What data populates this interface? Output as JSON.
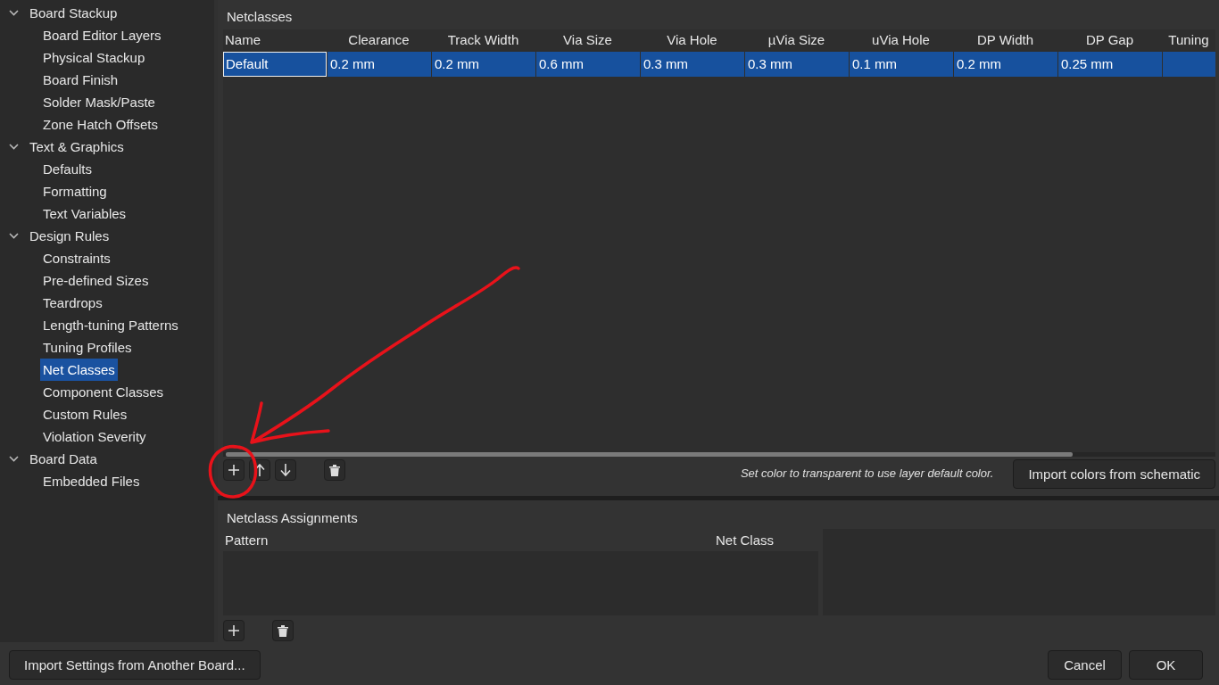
{
  "sidebar": {
    "items": [
      {
        "label": "Board Stackup",
        "expanded": true,
        "selected": false,
        "children": [
          {
            "label": "Board Editor Layers",
            "selected": false
          },
          {
            "label": "Physical Stackup",
            "selected": false
          },
          {
            "label": "Board Finish",
            "selected": false
          },
          {
            "label": "Solder Mask/Paste",
            "selected": false
          },
          {
            "label": "Zone Hatch Offsets",
            "selected": false
          }
        ]
      },
      {
        "label": "Text & Graphics",
        "expanded": true,
        "selected": false,
        "children": [
          {
            "label": "Defaults",
            "selected": false
          },
          {
            "label": "Formatting",
            "selected": false
          },
          {
            "label": "Text Variables",
            "selected": false
          }
        ]
      },
      {
        "label": "Design Rules",
        "expanded": true,
        "selected": false,
        "children": [
          {
            "label": "Constraints",
            "selected": false
          },
          {
            "label": "Pre-defined Sizes",
            "selected": false
          },
          {
            "label": "Teardrops",
            "selected": false
          },
          {
            "label": "Length-tuning Patterns",
            "selected": false
          },
          {
            "label": "Tuning Profiles",
            "selected": false
          },
          {
            "label": "Net Classes",
            "selected": true
          },
          {
            "label": "Component Classes",
            "selected": false
          },
          {
            "label": "Custom Rules",
            "selected": false
          },
          {
            "label": "Violation Severity",
            "selected": false
          }
        ]
      },
      {
        "label": "Board Data",
        "expanded": true,
        "selected": false,
        "children": [
          {
            "label": "Embedded Files",
            "selected": false
          }
        ]
      }
    ]
  },
  "netclasses": {
    "title": "Netclasses",
    "columns": [
      "Name",
      "Clearance",
      "Track Width",
      "Via Size",
      "Via Hole",
      "µVia Size",
      "uVia Hole",
      "DP Width",
      "DP Gap",
      "Tuning"
    ],
    "rows": [
      {
        "selected": true,
        "cells": [
          {
            "text": "Default",
            "focused": true
          },
          {
            "text": "0.2 mm",
            "focused": false
          },
          {
            "text": "0.2 mm",
            "focused": false
          },
          {
            "text": "0.6 mm",
            "focused": false
          },
          {
            "text": "0.3 mm",
            "focused": false
          },
          {
            "text": "0.3 mm",
            "focused": false
          },
          {
            "text": "0.1 mm",
            "focused": false
          },
          {
            "text": "0.2 mm",
            "focused": false
          },
          {
            "text": "0.25 mm",
            "focused": false
          }
        ]
      }
    ],
    "toolbar": [
      {
        "kind": "add"
      },
      {
        "kind": "up"
      },
      {
        "kind": "down"
      },
      {
        "kind": "delete"
      }
    ],
    "hint": "Set color to transparent to use layer default color.",
    "import_button": "Import colors from schematic"
  },
  "assignments": {
    "title": "Netclass Assignments",
    "columns": [
      "Pattern",
      "Net Class"
    ],
    "toolbar": [
      {
        "kind": "add"
      },
      {
        "kind": "delete"
      }
    ]
  },
  "footer": {
    "import_button": "Import Settings from Another Board...",
    "buttons": [
      "Cancel",
      "OK"
    ]
  },
  "annotations": [
    {
      "kind": "arrow"
    },
    {
      "kind": "circle"
    }
  ]
}
